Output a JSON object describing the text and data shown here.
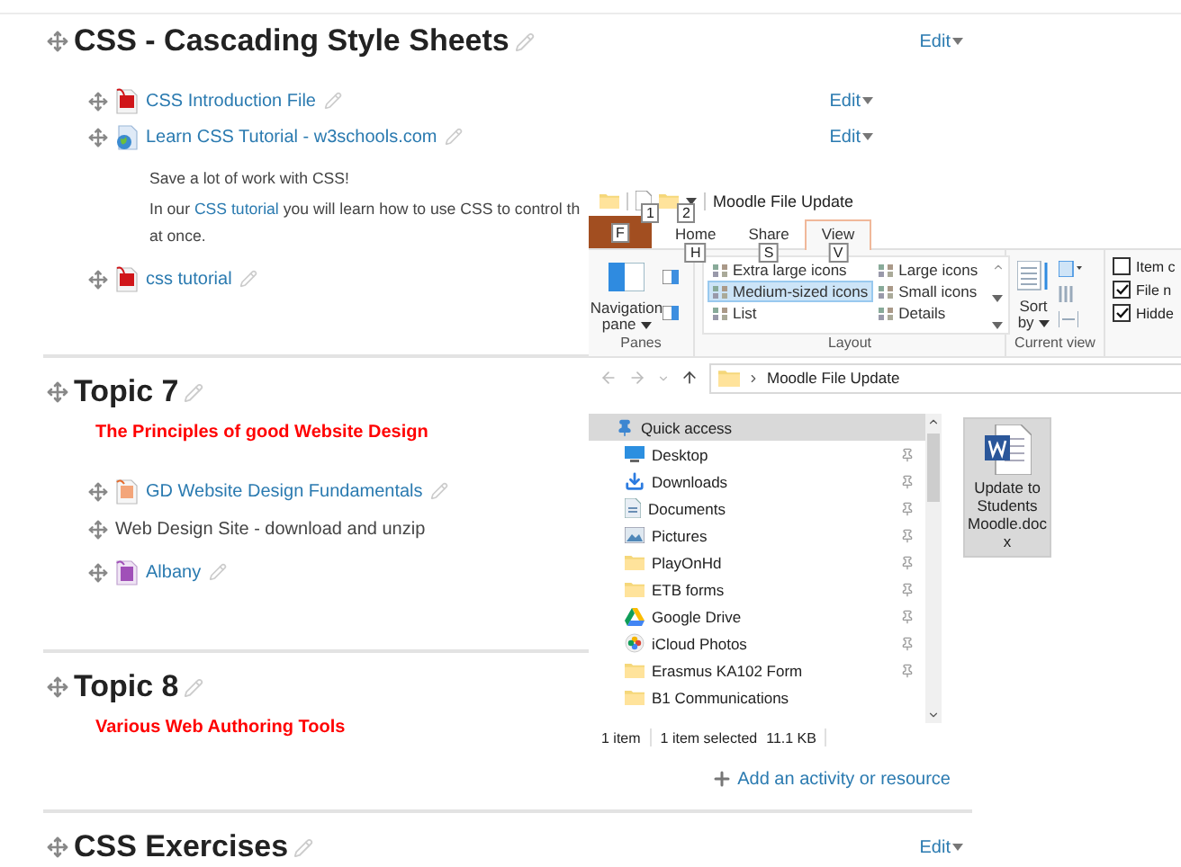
{
  "sections": [
    {
      "title": "CSS - Cascading Style Sheets",
      "edit": "Edit",
      "activities": [
        {
          "kind": "pdf",
          "name": "CSS Introduction File",
          "edit": "Edit"
        },
        {
          "kind": "web",
          "name": "Learn CSS Tutorial - w3schools.com",
          "edit": "Edit",
          "description": {
            "first": "Save a lot of work with CSS!",
            "before_link": "In our ",
            "link": "CSS tutorial",
            "after_link": " you will learn how to use CSS to control th",
            "second_line": "at once."
          }
        },
        {
          "kind": "pdf",
          "name": "css tutorial"
        }
      ]
    },
    {
      "title": "Topic 7",
      "summary": "The Principles of good Website Design",
      "activities": [
        {
          "kind": "ppt",
          "name": "GD Website Design Fundamentals"
        },
        {
          "kind": "label",
          "name": "Web Design Site - download and unzip"
        },
        {
          "kind": "page",
          "name": "Albany"
        }
      ]
    },
    {
      "title": "Topic 8",
      "summary": "Various Web Authoring Tools",
      "add_activity": "Add an activity or resource"
    },
    {
      "title": "CSS Exercises",
      "edit": "Edit"
    }
  ],
  "explorer": {
    "title": "Moodle File Update",
    "quick_access_keytips": [
      "1",
      "2"
    ],
    "tabs": [
      {
        "kind": "file",
        "keytip": "F",
        "selected": false
      },
      {
        "kind": "tab",
        "label": "Home",
        "keytip": "H",
        "selected": false
      },
      {
        "kind": "tab",
        "label": "Share",
        "keytip": "S",
        "selected": false
      },
      {
        "kind": "tab",
        "label": "View",
        "keytip": "V",
        "selected": true
      }
    ],
    "panes": {
      "button": "Navigation pane",
      "label": "Panes"
    },
    "layout": {
      "label": "Layout",
      "options": [
        {
          "label": "Extra large icons",
          "selected": false
        },
        {
          "label": "Large icons",
          "selected": false
        },
        {
          "label": "Medium-sized icons",
          "selected": true
        },
        {
          "label": "Small icons",
          "selected": false
        },
        {
          "label": "List",
          "selected": false
        },
        {
          "label": "Details",
          "selected": false
        }
      ]
    },
    "current_view": {
      "sort_button": "Sort by",
      "label": "Current view"
    },
    "show_hide": [
      {
        "label": "Item c",
        "checked": false
      },
      {
        "label": "File n",
        "checked": true
      },
      {
        "label": "Hidde",
        "checked": true
      }
    ],
    "address": {
      "path": "Moodle File Update"
    },
    "navigation": [
      {
        "label": "Quick access",
        "kind": "pin",
        "pinned": false,
        "selected": true
      },
      {
        "label": "Desktop",
        "kind": "desktop",
        "pinned": true,
        "selected": false
      },
      {
        "label": "Downloads",
        "kind": "download",
        "pinned": true,
        "selected": false
      },
      {
        "label": "Documents",
        "kind": "document",
        "pinned": true,
        "selected": false
      },
      {
        "label": "Pictures",
        "kind": "pictures",
        "pinned": true,
        "selected": false
      },
      {
        "label": "PlayOnHd",
        "kind": "folder",
        "pinned": true,
        "selected": false
      },
      {
        "label": "ETB forms",
        "kind": "folder",
        "pinned": true,
        "selected": false
      },
      {
        "label": "Google Drive",
        "kind": "drive",
        "pinned": true,
        "selected": false
      },
      {
        "label": "iCloud Photos",
        "kind": "photos",
        "pinned": true,
        "selected": false
      },
      {
        "label": "Erasmus KA102 Form",
        "kind": "folder",
        "pinned": true,
        "selected": false
      },
      {
        "label": "B1 Communications",
        "kind": "folder",
        "pinned": false,
        "selected": false
      }
    ],
    "files": [
      {
        "name": "Update to Students Moodle.docx",
        "selected": true
      }
    ],
    "status": {
      "count": "1 item",
      "selection": "1 item selected",
      "size": "11.1 KB"
    }
  }
}
